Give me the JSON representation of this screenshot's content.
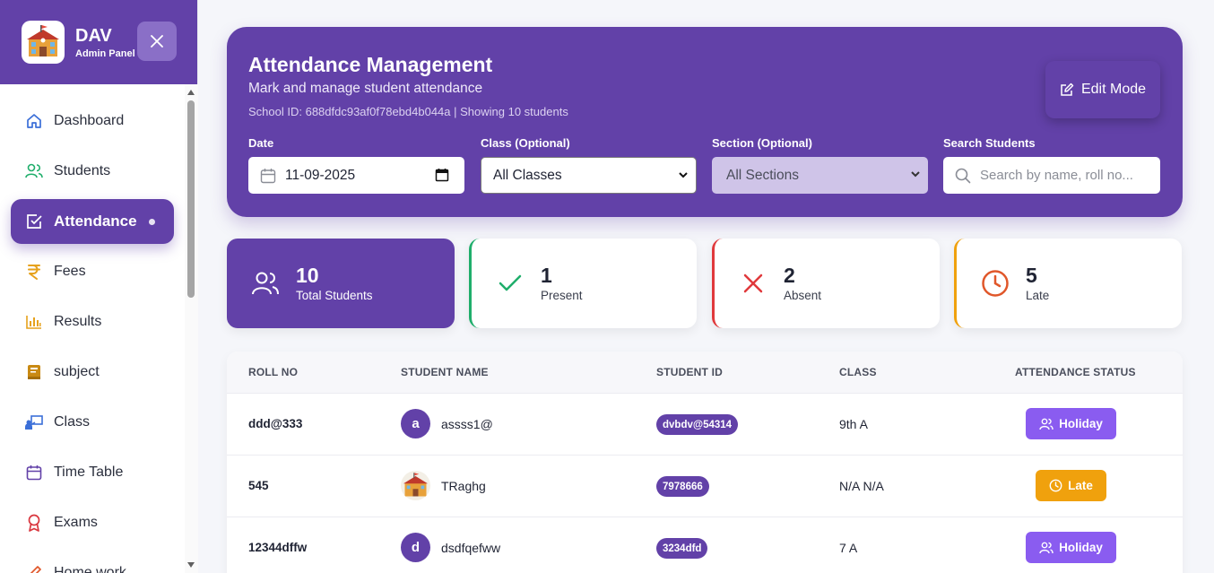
{
  "sidebar": {
    "brand_name": "DAV",
    "brand_sub": "Admin Panel",
    "items": [
      {
        "label": "Dashboard",
        "icon": "home-icon",
        "color": "#3b6fd8"
      },
      {
        "label": "Students",
        "icon": "users-icon",
        "color": "#1fae6b"
      },
      {
        "label": "Attendance",
        "icon": "check-square-icon",
        "active": true
      },
      {
        "label": "Fees",
        "icon": "rupee-icon",
        "color": "#e6a11b"
      },
      {
        "label": "Results",
        "icon": "bar-chart-icon",
        "color": "#e6a11b"
      },
      {
        "label": "subject",
        "icon": "book-icon",
        "color": "#c98a14"
      },
      {
        "label": "Class",
        "icon": "class-board-icon",
        "color": "#3b6fd8"
      },
      {
        "label": "Time Table",
        "icon": "calendar-icon",
        "color": "#6241a8"
      },
      {
        "label": "Exams",
        "icon": "award-icon",
        "color": "#d9363e"
      },
      {
        "label": "Home work",
        "icon": "pencil-icon",
        "color": "#e0572a"
      }
    ]
  },
  "header": {
    "title": "Attendance Management",
    "subtitle": "Mark and manage student attendance",
    "info": "School ID: 688dfdc93af0f78ebd4b044a | Showing 10 students",
    "edit_label": "Edit Mode",
    "filters": {
      "date_label": "Date",
      "date_value": "11-09-2025",
      "class_label": "Class (Optional)",
      "class_value": "All Classes",
      "section_label": "Section (Optional)",
      "section_value": "All Sections",
      "search_label": "Search Students",
      "search_placeholder": "Search by name, roll no..."
    }
  },
  "stats": {
    "total": {
      "value": "10",
      "label": "Total Students"
    },
    "present": {
      "value": "1",
      "label": "Present"
    },
    "absent": {
      "value": "2",
      "label": "Absent"
    },
    "late": {
      "value": "5",
      "label": "Late"
    }
  },
  "table": {
    "headers": [
      "ROLL NO",
      "STUDENT NAME",
      "STUDENT ID",
      "CLASS",
      "ATTENDANCE STATUS"
    ],
    "rows": [
      {
        "roll": "ddd@333",
        "avatar": "a",
        "name": "assss1@",
        "student_id": "dvbdv@54314",
        "class": "9th A",
        "status": "Holiday"
      },
      {
        "roll": "545",
        "avatar": "",
        "name": "TRaghg",
        "student_id": "7978666",
        "class": "N/A N/A",
        "status": "Late"
      },
      {
        "roll": "12344dffw",
        "avatar": "d",
        "name": "dsdfqefww",
        "student_id": "3234dfd",
        "class": "7 A",
        "status": "Holiday"
      }
    ]
  },
  "colors": {
    "primary": "#6241a8",
    "present": "#1fae6b",
    "absent": "#e0393c",
    "late": "#f0a10d",
    "holiday": "#8a5cf0"
  }
}
